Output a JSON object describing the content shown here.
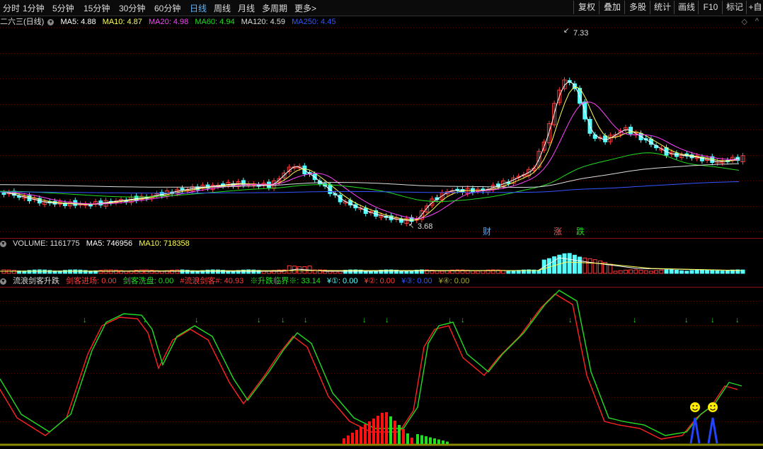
{
  "toolbar": {
    "periods": [
      "分时",
      "1分钟",
      "5分钟",
      "15分钟",
      "30分钟",
      "60分钟",
      "日线",
      "周线",
      "月线",
      "多周期",
      "更多>"
    ],
    "active_period": "日线",
    "right_buttons": [
      "复权",
      "叠加",
      "多股",
      "统计",
      "画线",
      "F10",
      "标记",
      "+自"
    ]
  },
  "main_legend": {
    "title": "二六三(日线)",
    "ma5": "MA5: 4.88",
    "ma10": "MA10: 4.87",
    "ma20": "MA20: 4.98",
    "ma60": "MA60: 4.94",
    "ma120": "MA120: 4.59",
    "ma250": "MA250: 4.45",
    "high_label": "7.33",
    "low_label": "3.68",
    "markers": [
      "财",
      "涨",
      "跌"
    ]
  },
  "volume_legend": {
    "volume": "VOLUME: 1161775",
    "ma5": "MA5: 746956",
    "ma10": "MA10: 718358"
  },
  "indicator_legend": {
    "name": "流浪剑客升跌",
    "enter": "剑客进场: 0.00",
    "wash": "剑客洗盘: 0.00",
    "swordsman": "#流浪剑客#: 40.93",
    "critical": "※升跌临界※: 33.14",
    "y1": "¥①: 0.00",
    "y2": "¥②: 0.00",
    "y3": "¥③: 0.00",
    "y4": "¥④: 0.00"
  },
  "colors": {
    "up": "#ff3c3c",
    "down": "#54ffff",
    "ma5": "#ffffff",
    "ma10": "#ffff55",
    "ma20": "#ff44ff",
    "ma60": "#22dd22",
    "ma120": "#dddddd",
    "ma250": "#3355ff"
  }
}
